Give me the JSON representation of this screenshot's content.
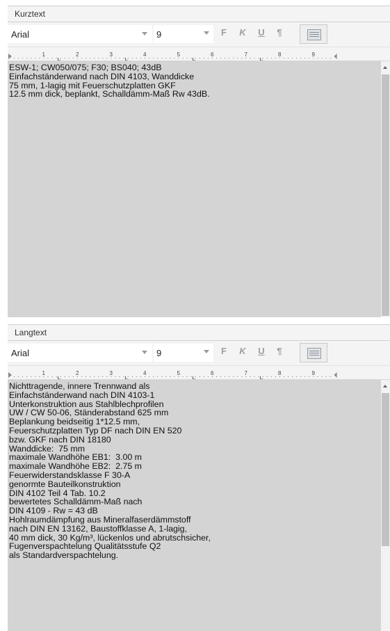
{
  "kurztext": {
    "header": "Kurztext",
    "font": "Arial",
    "size": "9",
    "bold": "F",
    "italic": "K",
    "underline": "U",
    "pilcrow": "¶",
    "ruler_marks": [
      "1",
      "2",
      "3",
      "4",
      "5",
      "6",
      "7",
      "8",
      "9"
    ],
    "lines": [
      "ESW-1; CW050/075; F30; BS040; 43dB",
      "Einfachständerwand nach DIN 4103, Wanddicke",
      "75 mm, 1-lagig mit Feuerschutzplatten GKF",
      "12.5 mm dick, beplankt, Schalldämm-Maß Rw 43dB."
    ]
  },
  "langtext": {
    "header": "Langtext",
    "font": "Arial",
    "size": "9",
    "bold": "F",
    "italic": "K",
    "underline": "U",
    "pilcrow": "¶",
    "ruler_marks": [
      "1",
      "2",
      "3",
      "4",
      "5",
      "6",
      "7",
      "8",
      "9"
    ],
    "lines": [
      "Nichttragende, innere Trennwand als",
      "Einfachständerwand nach DIN 4103-1",
      "Unterkonstruktion aus Stahlblechprofilen",
      "UW / CW 50-06, Ständerabstand 625 mm",
      "Beplankung beidseitig 1*12.5 mm,",
      "Feuerschutzplatten Typ DF nach DIN EN 520",
      "bzw. GKF nach DIN 18180",
      "Wanddicke:  75 mm",
      "maximale Wandhöhe EB1:  3.00 m",
      "maximale Wandhöhe EB2:  2.75 m",
      "Feuerwiderstandsklasse F 30-A",
      "genormte Bauteilkonstruktion",
      "DIN 4102 Teil 4 Tab. 10.2",
      "bewertetes Schalldämm-Maß nach",
      "DIN 4109 - Rw = 43 dB",
      "Hohlraumdämpfung aus Mineralfaserdämmstoff",
      "nach DIN EN 13162, Baustoffklasse A, 1-lagig,",
      "40 mm dick, 30 Kg/m³, lückenlos und abrutschsicher,",
      "Fugenverspachtelung Qualitätsstufe Q2",
      "als Standardverspachtelung."
    ]
  }
}
